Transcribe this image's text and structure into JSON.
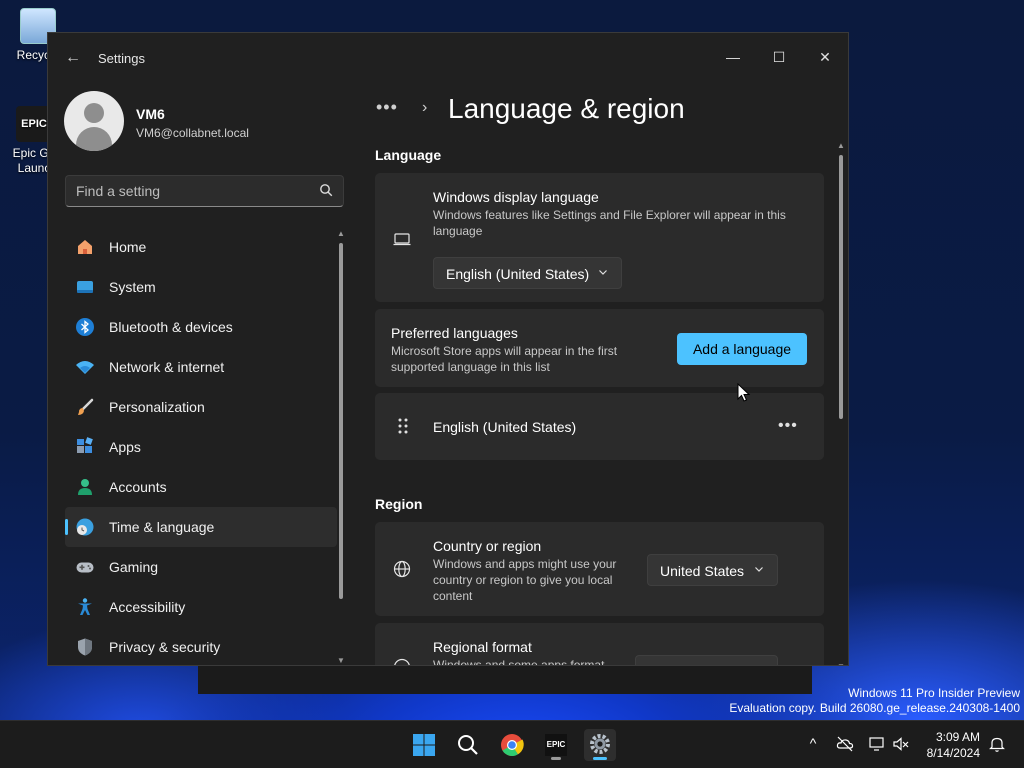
{
  "desktop": {
    "icons": [
      {
        "label": "Recycle"
      },
      {
        "label": "Epic Ga\nLaunc",
        "glyph": "EPIC"
      }
    ]
  },
  "window": {
    "app_title": "Settings",
    "back_glyph": "←",
    "minimize_glyph": "—",
    "maximize_glyph": "☐",
    "close_glyph": "✕"
  },
  "profile": {
    "name": "VM6",
    "email": "VM6@collabnet.local"
  },
  "search": {
    "placeholder": "Find a setting"
  },
  "sidebar": {
    "items": [
      {
        "label": "Home",
        "icon": "home-icon"
      },
      {
        "label": "System",
        "icon": "system-icon"
      },
      {
        "label": "Bluetooth & devices",
        "icon": "bluetooth-icon"
      },
      {
        "label": "Network & internet",
        "icon": "wifi-icon"
      },
      {
        "label": "Personalization",
        "icon": "brush-icon"
      },
      {
        "label": "Apps",
        "icon": "apps-icon"
      },
      {
        "label": "Accounts",
        "icon": "accounts-icon"
      },
      {
        "label": "Time & language",
        "icon": "time-language-icon",
        "active": true
      },
      {
        "label": "Gaming",
        "icon": "gaming-icon"
      },
      {
        "label": "Accessibility",
        "icon": "accessibility-icon"
      },
      {
        "label": "Privacy & security",
        "icon": "shield-icon"
      }
    ]
  },
  "main": {
    "breadcrumb_more": "•••",
    "breadcrumb_sep": "›",
    "page_title": "Language & region",
    "language_section": "Language",
    "display_language": {
      "title": "Windows display language",
      "description": "Windows features like Settings and File Explorer will appear in this language",
      "selected": "English (United States)"
    },
    "preferred_languages": {
      "title": "Preferred languages",
      "description": "Microsoft Store apps will appear in the first supported language in this list",
      "add_button": "Add a language"
    },
    "installed_language": {
      "label": "English (United States)",
      "more_glyph": "•••"
    },
    "region_section": "Region",
    "country_region": {
      "title": "Country or region",
      "description": "Windows and apps might use your country or region to give you local content",
      "selected": "United States"
    },
    "regional_format": {
      "title": "Regional format",
      "description": "Windows and some apps format"
    }
  },
  "watermark": {
    "line1": "Windows 11 Pro Insider Preview",
    "line2": "Evaluation copy. Build 26080.ge_release.240308-1400"
  },
  "taskbar": {
    "epic_glyph": "EPIC",
    "time": "3:09 AM",
    "date": "8/14/2024",
    "tray_chevron": "^"
  },
  "colors": {
    "accent": "#4cc2ff",
    "window_bg": "#202020",
    "card_bg": "#2b2b2b"
  }
}
